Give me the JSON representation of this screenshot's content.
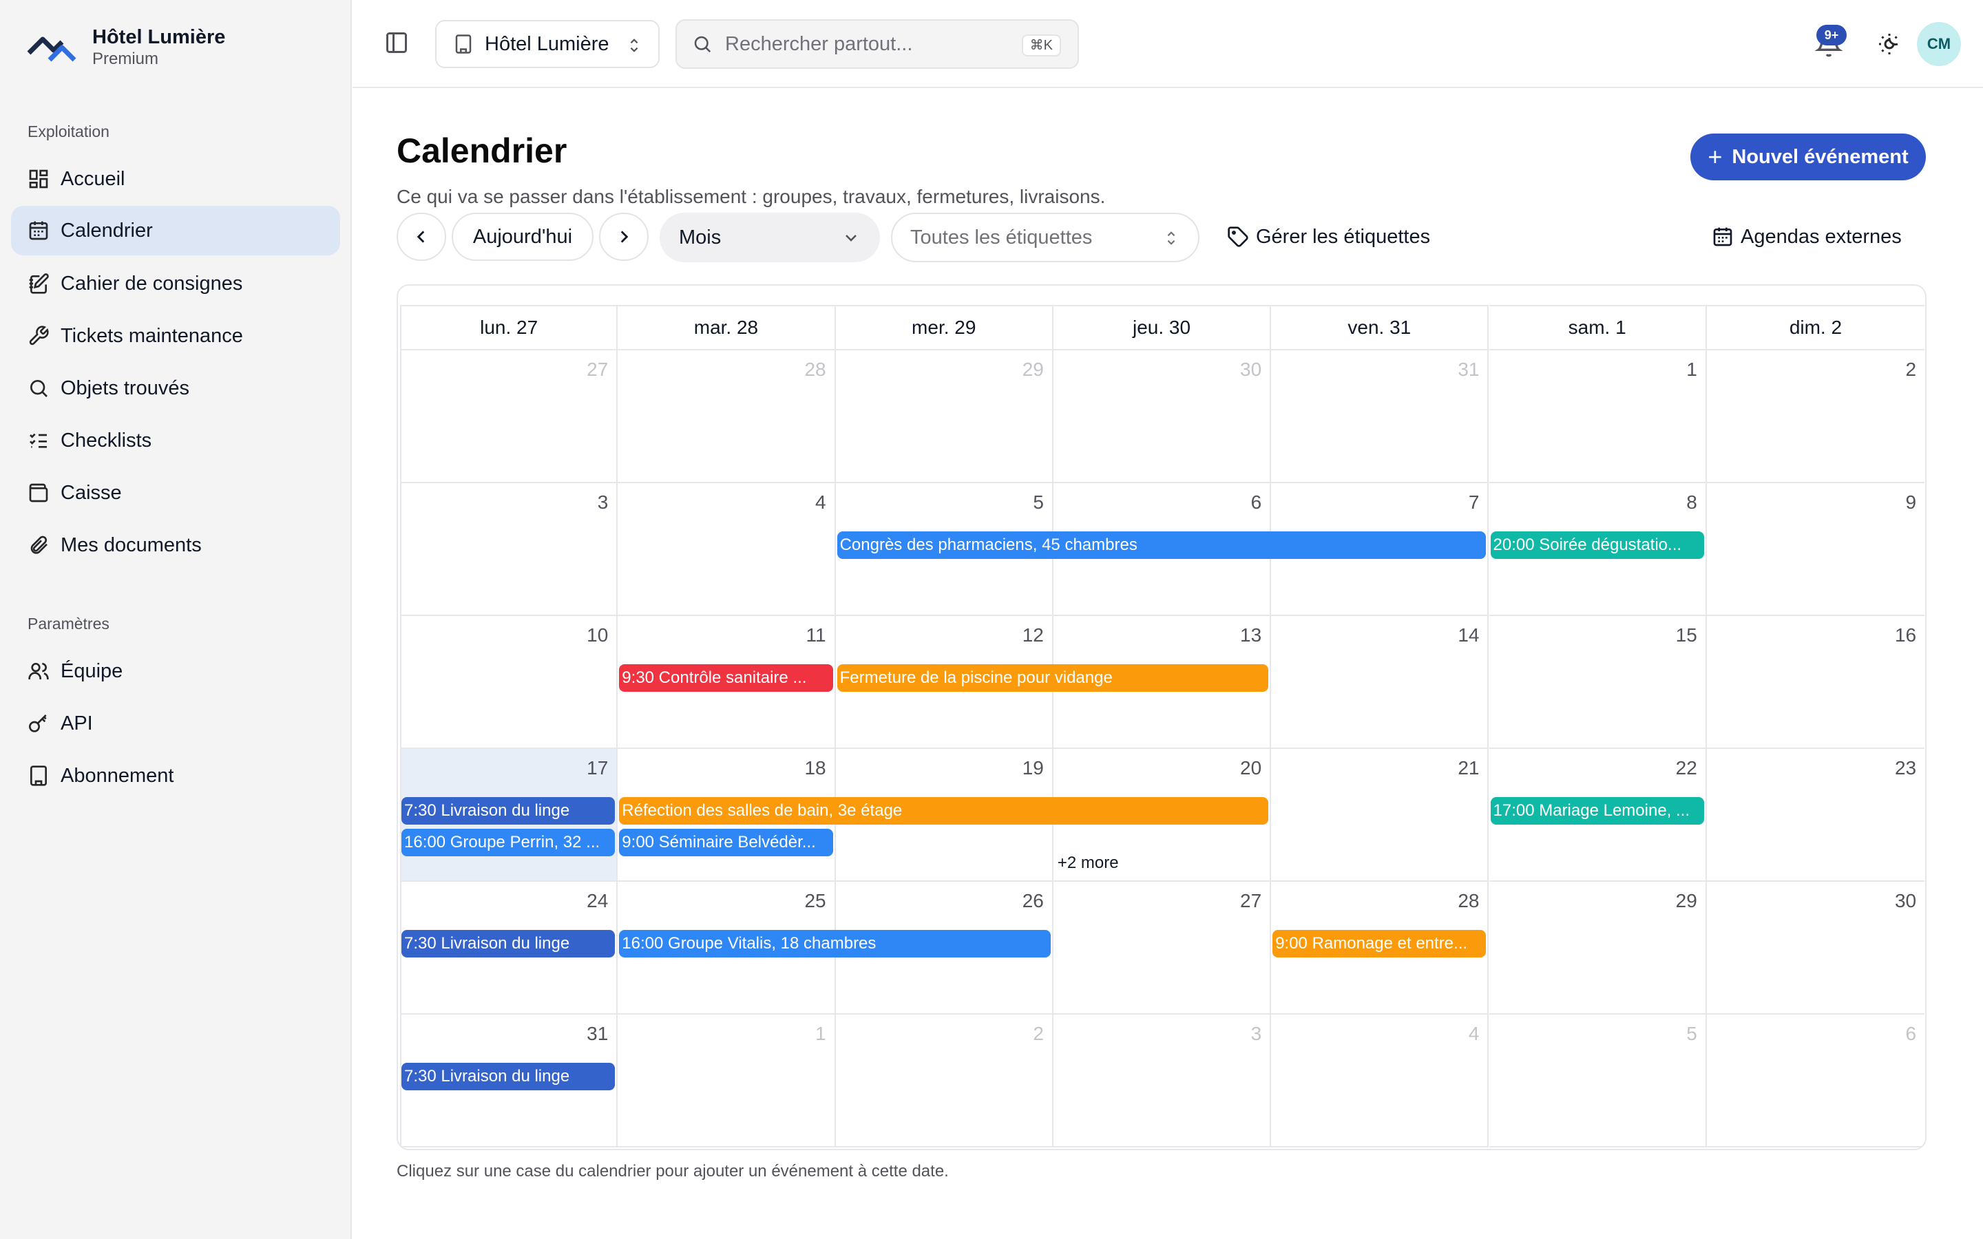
{
  "sidebar": {
    "brand_name": "Hôtel Lumière",
    "brand_plan": "Premium",
    "section_ops": "Exploitation",
    "section_settings": "Paramètres",
    "items": [
      {
        "label": "Accueil"
      },
      {
        "label": "Calendrier"
      },
      {
        "label": "Cahier de consignes"
      },
      {
        "label": "Tickets maintenance"
      },
      {
        "label": "Objets trouvés"
      },
      {
        "label": "Checklists"
      },
      {
        "label": "Caisse"
      },
      {
        "label": "Mes documents"
      }
    ],
    "settings_items": [
      {
        "label": "Équipe"
      },
      {
        "label": "API"
      },
      {
        "label": "Abonnement"
      }
    ]
  },
  "topbar": {
    "hotel": "Hôtel Lumière",
    "search_placeholder": "Rechercher partout...",
    "search_shortcut": "⌘K",
    "notif_badge": "9+",
    "avatar_initials": "CM"
  },
  "main": {
    "title": "Calendrier",
    "subtitle": "Ce qui va se passer dans l'établissement : groupes, travaux, fermetures, livraisons.",
    "new_event": "Nouvel événement",
    "today": "Aujourd'hui",
    "view": "Mois",
    "tags_placeholder": "Toutes les étiquettes",
    "manage_tags": "Gérer les étiquettes",
    "external": "Agendas externes",
    "footer": "Cliquez sur une case du calendrier pour ajouter un événement à cette date."
  },
  "calendar": {
    "headers": [
      "lun. 27",
      "mar. 28",
      "mer. 29",
      "jeu. 30",
      "ven. 31",
      "sam. 1",
      "dim. 2"
    ],
    "weeks": [
      [
        "27",
        "28",
        "29",
        "30",
        "31",
        "1",
        "2"
      ],
      [
        "3",
        "4",
        "5",
        "6",
        "7",
        "8",
        "9"
      ],
      [
        "10",
        "11",
        "12",
        "13",
        "14",
        "15",
        "16"
      ],
      [
        "17",
        "18",
        "19",
        "20",
        "21",
        "22",
        "23"
      ],
      [
        "24",
        "25",
        "26",
        "27",
        "28",
        "29",
        "30"
      ],
      [
        "31",
        "1",
        "2",
        "3",
        "4",
        "5",
        "6"
      ]
    ],
    "other_month": [
      [
        0,
        0
      ],
      [
        0,
        1
      ],
      [
        0,
        2
      ],
      [
        0,
        3
      ],
      [
        0,
        4
      ],
      [
        5,
        1
      ],
      [
        5,
        2
      ],
      [
        5,
        3
      ],
      [
        5,
        4
      ],
      [
        5,
        5
      ],
      [
        5,
        6
      ]
    ],
    "today": [
      3,
      0
    ],
    "events": [
      {
        "week": 1,
        "day": 2,
        "span": 3,
        "color": "blue",
        "label": "Congrès des pharmaciens, 45 chambres"
      },
      {
        "week": 1,
        "day": 5,
        "span": 1,
        "color": "teal",
        "label": "20:00 Soirée dégustatio..."
      },
      {
        "week": 2,
        "day": 1,
        "span": 1,
        "color": "red",
        "label": "9:30 Contrôle sanitaire ..."
      },
      {
        "week": 2,
        "day": 2,
        "span": 2,
        "color": "orange",
        "label": "Fermeture de la piscine pour vidange"
      },
      {
        "week": 3,
        "day": 0,
        "span": 1,
        "color": "navy",
        "label": "7:30 Livraison du linge"
      },
      {
        "week": 3,
        "day": 1,
        "span": 3,
        "color": "orange",
        "label": "Réfection des salles de bain, 3e étage"
      },
      {
        "week": 3,
        "day": 5,
        "span": 1,
        "color": "teal",
        "label": "17:00 Mariage Lemoine, ..."
      },
      {
        "week": 3,
        "day": 0,
        "span": 1,
        "color": "blue",
        "label": "16:00 Groupe Perrin, 32 ...",
        "row": 2
      },
      {
        "week": 3,
        "day": 1,
        "span": 1,
        "color": "blue",
        "label": "9:00 Séminaire Belvédèr...",
        "row": 2
      },
      {
        "week": 4,
        "day": 0,
        "span": 1,
        "color": "navy",
        "label": "7:30 Livraison du linge"
      },
      {
        "week": 4,
        "day": 1,
        "span": 2,
        "color": "blue",
        "label": "16:00 Groupe Vitalis, 18 chambres"
      },
      {
        "week": 4,
        "day": 4,
        "span": 1,
        "color": "orange",
        "label": "9:00 Ramonage et entre..."
      },
      {
        "week": 5,
        "day": 0,
        "span": 1,
        "color": "navy",
        "label": "7:30 Livraison du linge"
      }
    ],
    "more_label": "+2 more",
    "more_week": 3,
    "more_day": 3
  }
}
